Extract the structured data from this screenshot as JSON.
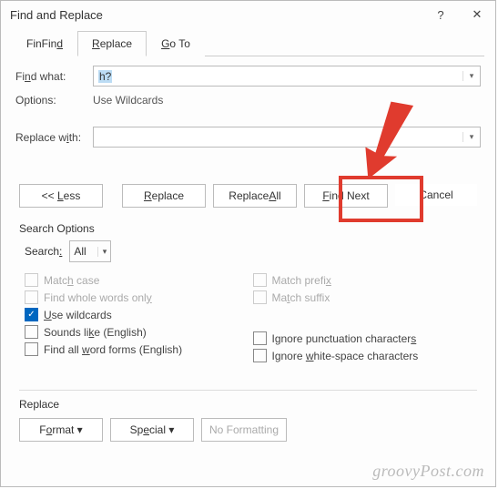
{
  "titlebar": {
    "title": "Find and Replace",
    "help": "?",
    "close": "✕"
  },
  "tabs": {
    "find": {
      "label": "Find",
      "underline": 3
    },
    "replace": {
      "label": "Replace",
      "underline": 0
    },
    "goto": {
      "label": "Go To",
      "underline": 0
    }
  },
  "findwhat": {
    "label": "Find what:",
    "value": "h?",
    "underline": 2
  },
  "options": {
    "label": "Options:",
    "value": "Use Wildcards"
  },
  "replacewith": {
    "label": "Replace with:",
    "value": "",
    "underline": 8
  },
  "buttons": {
    "less": "<< Less",
    "replace": "Replace",
    "replaceall": "Replace All",
    "findnext": "Find Next",
    "cancel": "Cancel"
  },
  "searchoptions": {
    "title": "Search Options",
    "search_label": "Search:",
    "search_value": "All",
    "left": [
      {
        "label": "Match case",
        "state": "disabled"
      },
      {
        "label": "Find whole words only",
        "state": "disabled"
      },
      {
        "label": "Use wildcards",
        "state": "checked"
      },
      {
        "label": "Sounds like (English)",
        "state": "unchecked"
      },
      {
        "label": "Find all word forms (English)",
        "state": "unchecked"
      }
    ],
    "right": [
      {
        "label": "Match prefix",
        "state": "disabled"
      },
      {
        "label": "Match suffix",
        "state": "disabled"
      },
      {
        "label": "",
        "state": "spacer"
      },
      {
        "label": "Ignore punctuation characters",
        "state": "unchecked"
      },
      {
        "label": "Ignore white-space characters",
        "state": "unchecked"
      }
    ]
  },
  "replace_section": {
    "title": "Replace"
  },
  "formatrow": {
    "format": "Format ▾",
    "special": "Special ▾",
    "noformat": "No Formatting"
  },
  "watermark": "groovyPost.com"
}
